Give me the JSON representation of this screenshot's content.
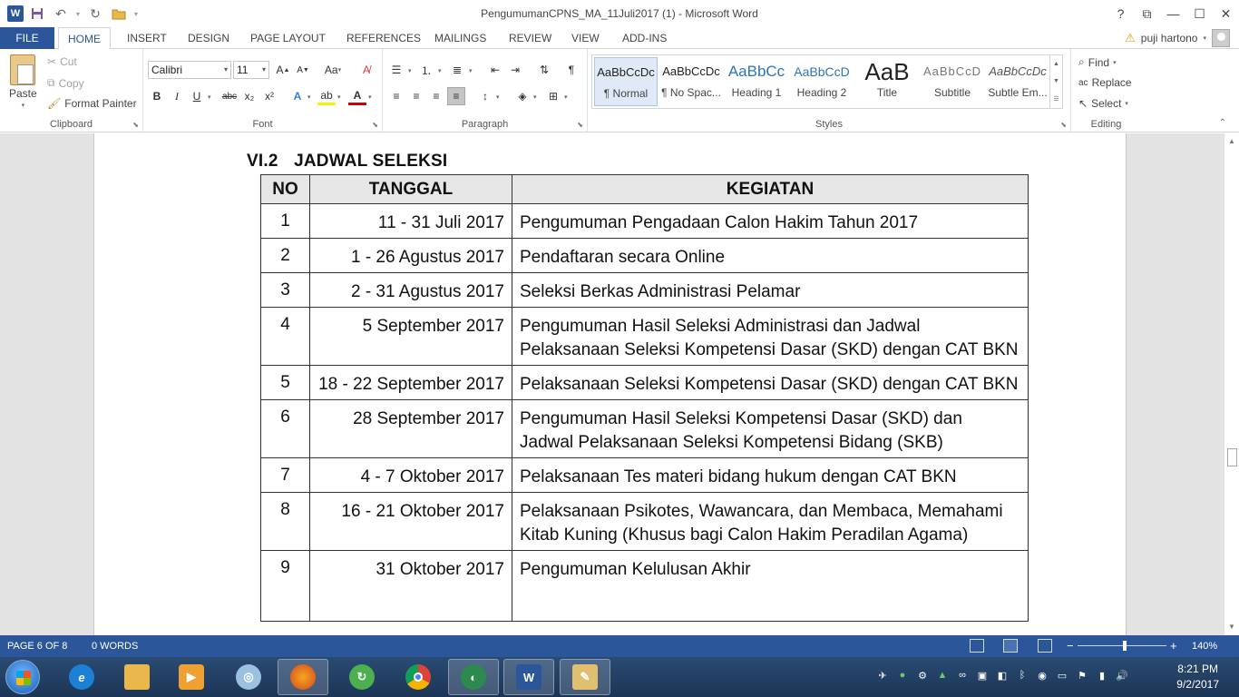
{
  "window": {
    "title": "PengumumanCPNS_MA_11Juli2017 (1) - Microsoft Word",
    "help": "?",
    "restore_ribbon": "⧉",
    "minimize": "—",
    "maximize": "☐",
    "close": "✕"
  },
  "tabs": {
    "file": "FILE",
    "home": "HOME",
    "insert": "INSERT",
    "design": "DESIGN",
    "page_layout": "PAGE LAYOUT",
    "references": "REFERENCES",
    "mailings": "MAILINGS",
    "review": "REVIEW",
    "view": "VIEW",
    "addins": "ADD-INS"
  },
  "user": {
    "name": "puji hartono"
  },
  "clipboard": {
    "paste": "Paste",
    "cut": "Cut",
    "copy": "Copy",
    "format_painter": "Format Painter",
    "label": "Clipboard"
  },
  "font": {
    "family": "Calibri",
    "size": "11",
    "label": "Font",
    "bold": "B",
    "italic": "I",
    "underline": "U",
    "strike": "abc",
    "sub": "x₂",
    "sup": "x²",
    "change_case": "Aa"
  },
  "paragraph": {
    "label": "Paragraph"
  },
  "styles": {
    "label": "Styles",
    "items": [
      {
        "preview": "AaBbCcDc",
        "name": "¶ Normal"
      },
      {
        "preview": "AaBbCcDc",
        "name": "¶ No Spac..."
      },
      {
        "preview": "AaBbCc",
        "name": "Heading 1"
      },
      {
        "preview": "AaBbCcD",
        "name": "Heading 2"
      },
      {
        "preview": "AaB",
        "name": "Title"
      },
      {
        "preview": "AaBbCcD",
        "name": "Subtitle"
      },
      {
        "preview": "AaBbCcDc",
        "name": "Subtle Em..."
      }
    ]
  },
  "editing": {
    "label": "Editing",
    "find": "Find",
    "replace": "Replace",
    "select": "Select"
  },
  "document": {
    "section_number": "VI.2",
    "section_title": "JADWAL SELEKSI",
    "headers": {
      "no": "NO",
      "tanggal": "TANGGAL",
      "kegiatan": "KEGIATAN"
    },
    "rows": [
      {
        "no": "1",
        "date": "11 - 31 Juli 2017",
        "activity": "Pengumuman Pengadaan Calon Hakim Tahun 2017"
      },
      {
        "no": "2",
        "date": "1 - 26 Agustus 2017",
        "activity": "Pendaftaran secara Online"
      },
      {
        "no": "3",
        "date": "2 - 31 Agustus 2017",
        "activity": "Seleksi Berkas Administrasi Pelamar"
      },
      {
        "no": "4",
        "date": "5 September 2017",
        "activity": "Pengumuman Hasil Seleksi Administrasi dan Jadwal Pelaksanaan Seleksi Kompetensi Dasar (SKD) dengan CAT BKN"
      },
      {
        "no": "5",
        "date": "18 - 22 September 2017",
        "activity": "Pelaksanaan Seleksi Kompetensi Dasar (SKD) dengan CAT BKN"
      },
      {
        "no": "6",
        "date": "28 September 2017",
        "activity": "Pengumuman Hasil Seleksi Kompetensi Dasar (SKD) dan Jadwal Pelaksanaan Seleksi Kompetensi Bidang (SKB)"
      },
      {
        "no": "7",
        "date": "4 - 7 Oktober 2017",
        "activity": "Pelaksanaan Tes materi bidang hukum dengan CAT BKN"
      },
      {
        "no": "8",
        "date": "16 - 21 Oktober 2017",
        "activity": "Pelaksanaan Psikotes, Wawancara, dan Membaca, Memahami Kitab Kuning (Khusus bagi Calon Hakim Peradilan Agama)"
      },
      {
        "no": "9",
        "date": "31 Oktober 2017",
        "activity": "Pengumuman Kelulusan Akhir"
      }
    ]
  },
  "status": {
    "page": "PAGE 6 OF 8",
    "words": "0 WORDS",
    "zoom": "140%",
    "zoom_out": "−",
    "zoom_in": "+"
  },
  "taskbar": {
    "time": "8:21 PM",
    "date": "9/2/2017",
    "apps": [
      "internet-explorer",
      "file-explorer",
      "media-player",
      "disc-tool",
      "firefox",
      "green-app",
      "chrome",
      "network-tool",
      "word",
      "paint"
    ]
  },
  "colors": {
    "accent": "#2b579a",
    "taskbar": "#1f3a5f"
  }
}
